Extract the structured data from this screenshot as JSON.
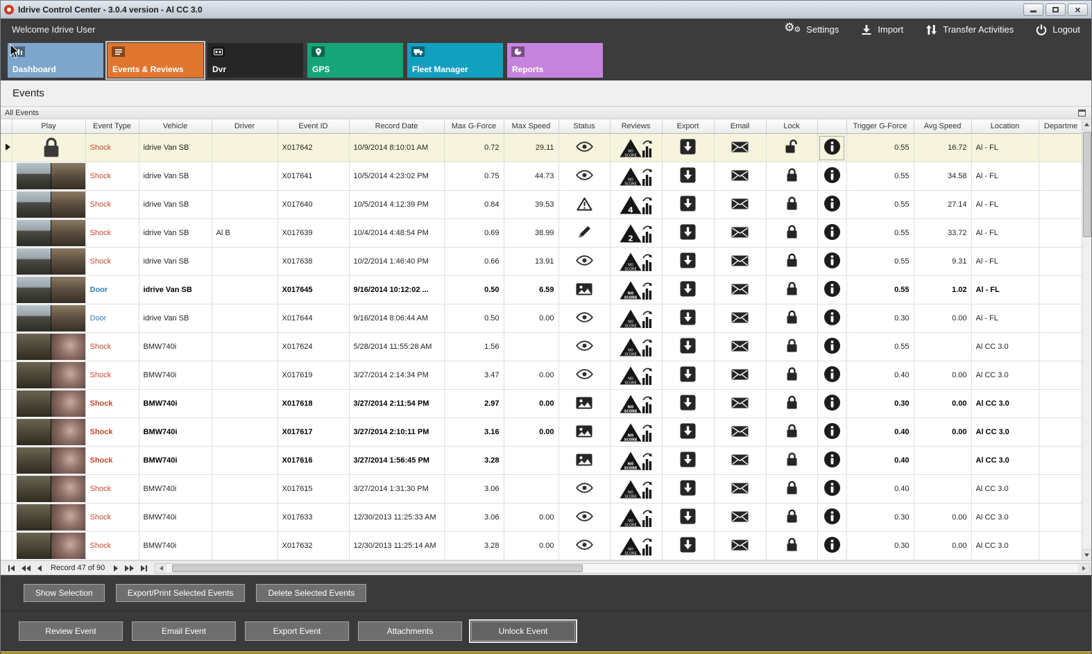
{
  "window": {
    "title": "Idrive Control Center - 3.0.4 version - Al CC 3.0"
  },
  "topbar": {
    "welcome": "Welcome Idrive User",
    "actions": [
      {
        "id": "settings",
        "label": "Settings",
        "icon": "gears-icon"
      },
      {
        "id": "import",
        "label": "Import",
        "icon": "import-icon"
      },
      {
        "id": "transfer-activities",
        "label": "Transfer Activities",
        "icon": "transfer-icon"
      },
      {
        "id": "logout",
        "label": "Logout",
        "icon": "power-icon"
      }
    ]
  },
  "tabs": [
    {
      "label": "Dashboard",
      "color": "#7ea6cd",
      "icon": "dashboard-icon",
      "active": false
    },
    {
      "label": "Events & Reviews",
      "color": "#e0762f",
      "icon": "events-icon",
      "active": true
    },
    {
      "label": "Dvr",
      "color": "#262626",
      "icon": "dvr-icon",
      "active": false
    },
    {
      "label": "GPS",
      "color": "#16a578",
      "icon": "gps-pin-icon",
      "active": false
    },
    {
      "label": "Fleet Manager",
      "color": "#12a0bf",
      "icon": "fleet-icon",
      "active": false
    },
    {
      "label": "Reports",
      "color": "#c683dd",
      "icon": "reports-icon",
      "active": false
    }
  ],
  "page": {
    "title": "Events",
    "group_header": "All Events"
  },
  "grid": {
    "columns": [
      "",
      "Play",
      "Event Type",
      "Vehicle",
      "Driver",
      "Event ID",
      "Record Date",
      "Max G-Force",
      "Max Speed",
      "Status",
      "Reviews",
      "Export",
      "Email",
      "Lock",
      "",
      "Trigger G-Force",
      "Avg Speed",
      "Location",
      "Departme"
    ],
    "rows": [
      {
        "selected": true,
        "thumb": "lock",
        "event_type": "Shock",
        "type_style": "shock",
        "bold": false,
        "vehicle": "idrive Van SB",
        "driver": "",
        "event_id": "X017642",
        "record_date": "10/9/2014 8:10:01 AM",
        "max_g_force": "0.72",
        "max_speed": "29.11",
        "status_icon": "eye-icon",
        "review_badge": "NO SCORE",
        "lock_state": "unlocked",
        "trigger_g_force": "0.55",
        "avg_speed": "16.72",
        "location": "Al - FL",
        "info_focused": true
      },
      {
        "selected": false,
        "thumb": "van",
        "event_type": "Shock",
        "type_style": "shock",
        "bold": false,
        "vehicle": "idrive Van SB",
        "driver": "",
        "event_id": "X017641",
        "record_date": "10/5/2014 4:23:02 PM",
        "max_g_force": "0.75",
        "max_speed": "44.73",
        "status_icon": "eye-icon",
        "review_badge": "NO SCORE",
        "lock_state": "locked",
        "trigger_g_force": "0.55",
        "avg_speed": "34.58",
        "location": "Al - FL",
        "info_focused": false
      },
      {
        "selected": false,
        "thumb": "van",
        "event_type": "Shock",
        "type_style": "shock",
        "bold": false,
        "vehicle": "idrive Van SB",
        "driver": "",
        "event_id": "X017640",
        "record_date": "10/5/2014 4:12:39 PM",
        "max_g_force": "0.84",
        "max_speed": "39.53",
        "status_icon": "warning-icon",
        "review_badge": "4",
        "lock_state": "locked",
        "trigger_g_force": "0.55",
        "avg_speed": "27.14",
        "location": "Al - FL",
        "info_focused": false
      },
      {
        "selected": false,
        "thumb": "van",
        "event_type": "Shock",
        "type_style": "shock",
        "bold": false,
        "vehicle": "idrive Van SB",
        "driver": "Al B",
        "event_id": "X017639",
        "record_date": "10/4/2014 4:48:54 PM",
        "max_g_force": "0.69",
        "max_speed": "38.99",
        "status_icon": "pencil-icon",
        "review_badge": "2",
        "lock_state": "locked",
        "trigger_g_force": "0.55",
        "avg_speed": "33.72",
        "location": "Al - FL",
        "info_focused": false
      },
      {
        "selected": false,
        "thumb": "van",
        "event_type": "Shock",
        "type_style": "shock",
        "bold": false,
        "vehicle": "idrive Van SB",
        "driver": "",
        "event_id": "X017638",
        "record_date": "10/2/2014 1:46:40 PM",
        "max_g_force": "0.66",
        "max_speed": "13.91",
        "status_icon": "eye-icon",
        "review_badge": "NO SCORE",
        "lock_state": "locked",
        "trigger_g_force": "0.55",
        "avg_speed": "9.31",
        "location": "Al - FL",
        "info_focused": false
      },
      {
        "selected": false,
        "thumb": "van",
        "event_type": "Door",
        "type_style": "door",
        "bold": true,
        "vehicle": "idrive Van SB",
        "driver": "",
        "event_id": "X017645",
        "record_date": "9/16/2014 10:12:02 ...",
        "max_g_force": "0.50",
        "max_speed": "6.59",
        "status_icon": "photo-icon",
        "review_badge": "NO SCORE",
        "lock_state": "locked",
        "trigger_g_force": "0.55",
        "avg_speed": "1.02",
        "location": "Al - FL",
        "info_focused": false
      },
      {
        "selected": false,
        "thumb": "van",
        "event_type": "Door",
        "type_style": "door",
        "bold": false,
        "vehicle": "idrive Van SB",
        "driver": "",
        "event_id": "X017644",
        "record_date": "9/16/2014 8:06:44 AM",
        "max_g_force": "0.50",
        "max_speed": "0.00",
        "status_icon": "eye-icon",
        "review_badge": "NO SCORE",
        "lock_state": "locked",
        "trigger_g_force": "0.30",
        "avg_speed": "0.00",
        "location": "Al - FL",
        "info_focused": false
      },
      {
        "selected": false,
        "thumb": "bmw",
        "event_type": "Shock",
        "type_style": "shock",
        "bold": false,
        "vehicle": "BMW740i",
        "driver": "",
        "event_id": "X017624",
        "record_date": "5/28/2014 11:55:28 AM",
        "max_g_force": "1.56",
        "max_speed": "",
        "status_icon": "eye-icon",
        "review_badge": "NO SCORE",
        "lock_state": "locked",
        "trigger_g_force": "0.55",
        "avg_speed": "",
        "location": "Al CC 3.0",
        "info_focused": false
      },
      {
        "selected": false,
        "thumb": "bmw",
        "event_type": "Shock",
        "type_style": "shock",
        "bold": false,
        "vehicle": "BMW740i",
        "driver": "",
        "event_id": "X017619",
        "record_date": "3/27/2014 2:14:34 PM",
        "max_g_force": "3.47",
        "max_speed": "0.00",
        "status_icon": "eye-icon",
        "review_badge": "NO SCORE",
        "lock_state": "locked",
        "trigger_g_force": "0.40",
        "avg_speed": "0.00",
        "location": "Al CC 3.0",
        "info_focused": false
      },
      {
        "selected": false,
        "thumb": "bmw",
        "event_type": "Shock",
        "type_style": "shock",
        "bold": true,
        "vehicle": "BMW740i",
        "driver": "",
        "event_id": "X017618",
        "record_date": "3/27/2014 2:11:54 PM",
        "max_g_force": "2.97",
        "max_speed": "0.00",
        "status_icon": "photo-icon",
        "review_badge": "NO SCORE",
        "lock_state": "locked",
        "trigger_g_force": "0.30",
        "avg_speed": "0.00",
        "location": "Al CC 3.0",
        "info_focused": false
      },
      {
        "selected": false,
        "thumb": "bmw",
        "event_type": "Shock",
        "type_style": "shock",
        "bold": true,
        "vehicle": "BMW740i",
        "driver": "",
        "event_id": "X017617",
        "record_date": "3/27/2014 2:10:11 PM",
        "max_g_force": "3.16",
        "max_speed": "0.00",
        "status_icon": "photo-icon",
        "review_badge": "NO SCORE",
        "lock_state": "locked",
        "trigger_g_force": "0.40",
        "avg_speed": "0.00",
        "location": "Al CC 3.0",
        "info_focused": false
      },
      {
        "selected": false,
        "thumb": "bmw",
        "event_type": "Shock",
        "type_style": "shock",
        "bold": true,
        "vehicle": "BMW740i",
        "driver": "",
        "event_id": "X017616",
        "record_date": "3/27/2014 1:56:45 PM",
        "max_g_force": "3.28",
        "max_speed": "",
        "status_icon": "photo-icon",
        "review_badge": "NO SCORE",
        "lock_state": "locked",
        "trigger_g_force": "0.40",
        "avg_speed": "",
        "location": "Al CC 3.0",
        "info_focused": false
      },
      {
        "selected": false,
        "thumb": "bmw",
        "event_type": "Shock",
        "type_style": "shock",
        "bold": false,
        "vehicle": "BMW740i",
        "driver": "",
        "event_id": "X017615",
        "record_date": "3/27/2014 1:31:30 PM",
        "max_g_force": "3.06",
        "max_speed": "",
        "status_icon": "eye-icon",
        "review_badge": "NO SCORE",
        "lock_state": "locked",
        "trigger_g_force": "0.40",
        "avg_speed": "",
        "location": "Al CC 3.0",
        "info_focused": false
      },
      {
        "selected": false,
        "thumb": "bmw",
        "event_type": "Shock",
        "type_style": "shock",
        "bold": false,
        "vehicle": "BMW740i",
        "driver": "",
        "event_id": "X017633",
        "record_date": "12/30/2013 11:25:33 AM",
        "max_g_force": "3.06",
        "max_speed": "0.00",
        "status_icon": "eye-icon",
        "review_badge": "NO SCORE",
        "lock_state": "locked",
        "trigger_g_force": "0.30",
        "avg_speed": "0.00",
        "location": "Al CC 3.0",
        "info_focused": false
      },
      {
        "selected": false,
        "thumb": "bmw",
        "event_type": "Shock",
        "type_style": "shock",
        "bold": false,
        "vehicle": "BMW740i",
        "driver": "",
        "event_id": "X017632",
        "record_date": "12/30/2013 11:25:14 AM",
        "max_g_force": "3.28",
        "max_speed": "0.00",
        "status_icon": "eye-icon",
        "review_badge": "NO SCORE",
        "lock_state": "locked",
        "trigger_g_force": "0.30",
        "avg_speed": "0.00",
        "location": "Al CC 3.0",
        "info_focused": false
      }
    ]
  },
  "pager": {
    "record_text": "Record 47 of 90"
  },
  "selection_bar": {
    "buttons": [
      "Show Selection",
      "Export/Print Selected Events",
      "Delete Selected  Events"
    ]
  },
  "event_actions": {
    "buttons": [
      "Review Event",
      "Email Event",
      "Export Event",
      "Attachments",
      "Unlock Event"
    ],
    "focused": "Unlock Event"
  }
}
